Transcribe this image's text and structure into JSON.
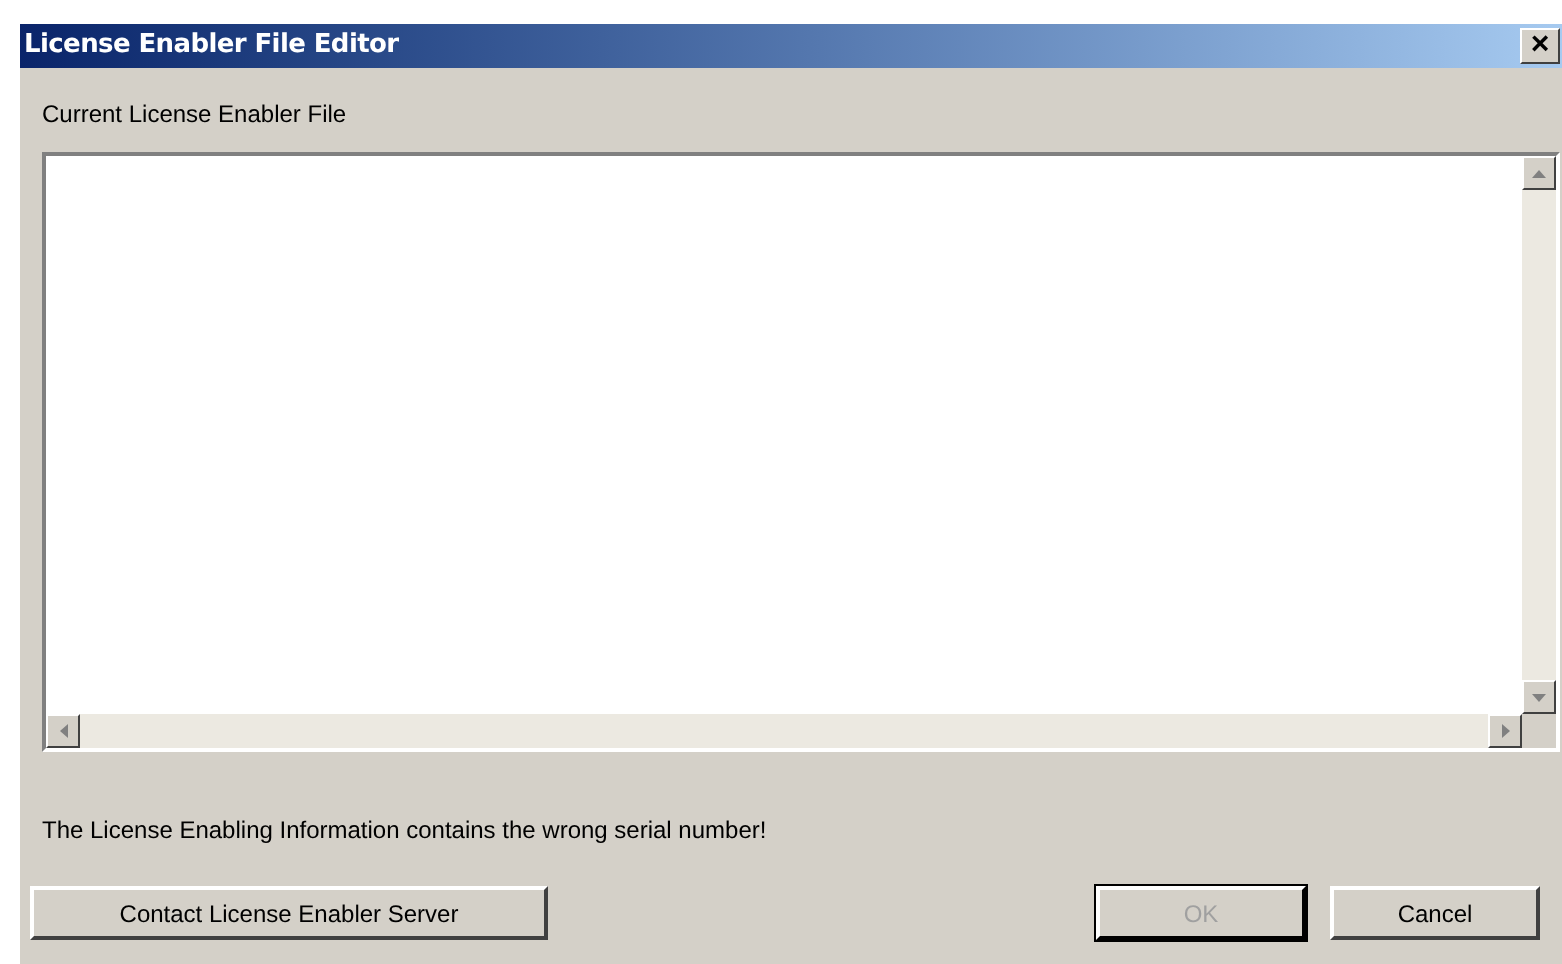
{
  "window": {
    "title": "License Enabler File Editor",
    "close": "×"
  },
  "editor": {
    "label": "Current License Enabler File"
  },
  "message": "The License Enabling Information contains the wrong serial number!",
  "buttons": [
    {
      "label": "Contact License Enabler Server",
      "disabled": false,
      "kind": "wide"
    },
    {
      "label": "OK",
      "disabled": true,
      "kind": "standard"
    },
    {
      "label": "Cancel",
      "disabled": false,
      "kind": "standard"
    }
  ]
}
